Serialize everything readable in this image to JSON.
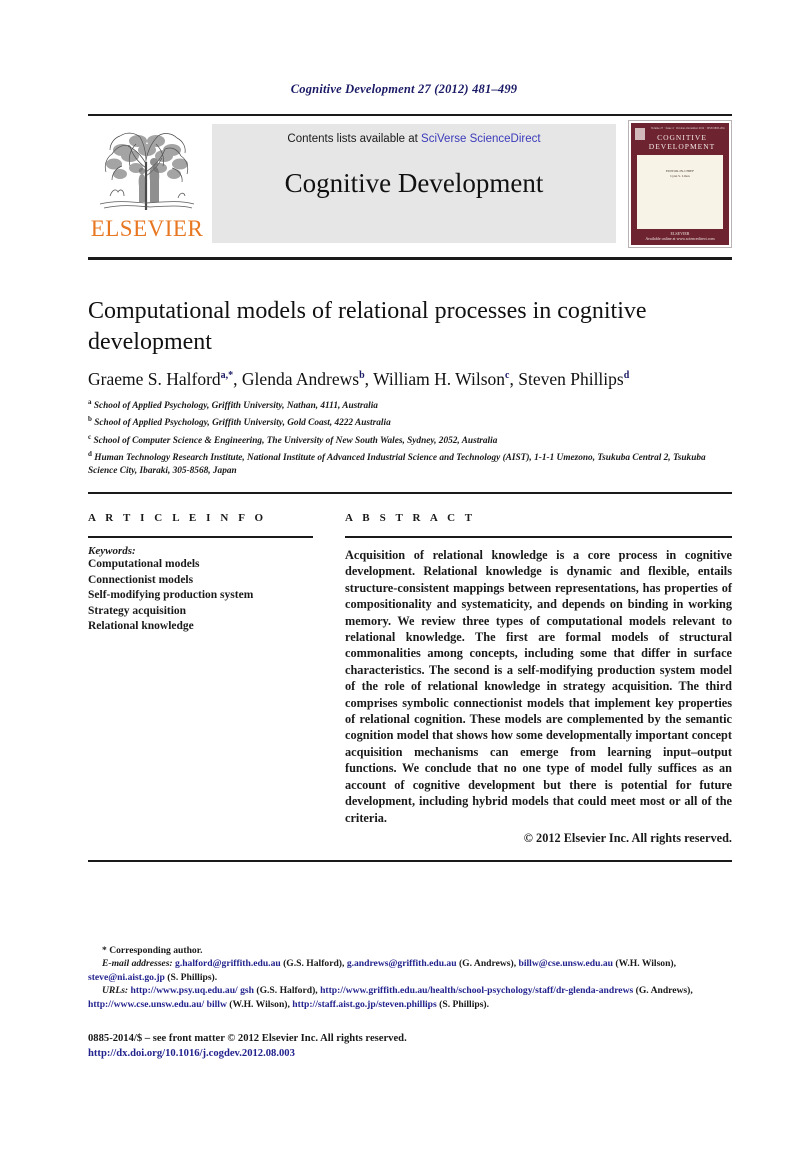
{
  "running_head": "Cognitive Development 27 (2012) 481–499",
  "masthead": {
    "publisher_name": "ELSEVIER",
    "publisher_logo_alt": "elsevier-tree-logo",
    "contents_prefix": "Contents lists available at ",
    "contents_link": "SciVerse ScienceDirect",
    "journal_name": "Cognitive Development",
    "cover": {
      "top_meta": "Volume 27 · Issue 4 · October–December 2012 · ISSN 0885-2014",
      "title_line1": "COGNITIVE",
      "title_line2": "DEVELOPMENT",
      "white_text_line1": "EDITOR-IN-CHIEF",
      "white_text_line2": "Lynn S. Liben",
      "foot_line1": "ELSEVIER",
      "foot_line2": "Available online at www.sciencedirect.com"
    }
  },
  "article": {
    "title": "Computational models of relational processes in cognitive development",
    "authors": [
      {
        "name": "Graeme S. Halford",
        "marks": "a,*"
      },
      {
        "name": "Glenda Andrews",
        "marks": "b"
      },
      {
        "name": "William H. Wilson",
        "marks": "c"
      },
      {
        "name": "Steven Phillips",
        "marks": "d"
      }
    ],
    "affiliations": [
      {
        "mark": "a",
        "text": "School of Applied Psychology, Griffith University, Nathan, 4111, Australia"
      },
      {
        "mark": "b",
        "text": "School of Applied Psychology, Griffith University, Gold Coast, 4222 Australia"
      },
      {
        "mark": "c",
        "text": "School of Computer Science & Engineering, The University of New South Wales, Sydney, 2052, Australia"
      },
      {
        "mark": "d",
        "text": "Human Technology Research Institute, National Institute of Advanced Industrial Science and Technology (AIST), 1-1-1 Umezono, Tsukuba Central 2, Tsukuba Science City, Ibaraki, 305-8568, Japan"
      }
    ]
  },
  "article_info": {
    "heading": "A R T I C L E   I N F O",
    "keywords_label": "Keywords:",
    "keywords": [
      "Computational models",
      "Connectionist models",
      "Self-modifying production system",
      "Strategy acquisition",
      "Relational knowledge"
    ]
  },
  "abstract": {
    "heading": "A B S T R A C T",
    "text": "Acquisition of relational knowledge is a core process in cognitive development. Relational knowledge is dynamic and flexible, entails structure-consistent mappings between representations, has properties of compositionality and systematicity, and depends on binding in working memory. We review three types of computational models relevant to relational knowledge. The first are formal models of structural commonalities among concepts, including some that differ in surface characteristics. The second is a self-modifying production system model of the role of relational knowledge in strategy acquisition. The third comprises symbolic connectionist models that implement key properties of relational cognition. These models are complemented by the semantic cognition model that shows how some developmentally important concept acquisition mechanisms can emerge from learning input–output functions. We conclude that no one type of model fully suffices as an account of cognitive development but there is potential for future development, including hybrid models that could meet most or all of the criteria.",
    "copyright": "© 2012 Elsevier Inc. All rights reserved."
  },
  "footnotes": {
    "corresponding_author": "* Corresponding author.",
    "email_label": "E-mail addresses:",
    "emails": [
      {
        "address": "g.halford@griffith.edu.au",
        "person": "(G.S. Halford)"
      },
      {
        "address": "g.andrews@griffith.edu.au",
        "person": "(G. Andrews)"
      },
      {
        "address": "billw@cse.unsw.edu.au",
        "person": "(W.H. Wilson)"
      },
      {
        "address": "steve@ni.aist.go.jp",
        "person": "(S. Phillips)"
      }
    ],
    "urls_label": "URLs:",
    "urls": [
      {
        "address": "http://www.psy.uq.edu.au/ gsh",
        "person": "(G.S. Halford)"
      },
      {
        "address": "http://www.griffith.edu.au/health/school-psychology/staff/dr-glenda-andrews",
        "person": "(G. Andrews)"
      },
      {
        "address": "http://www.cse.unsw.edu.au/ billw",
        "person": "(W.H. Wilson)"
      },
      {
        "address": "http://staff.aist.go.jp/steven.phillips",
        "person": "(S. Phillips)"
      }
    ]
  },
  "imprint": {
    "front_matter": "0885-2014/$ – see front matter © 2012 Elsevier Inc. All rights reserved.",
    "doi": "http://dx.doi.org/10.1016/j.cogdev.2012.08.003"
  },
  "colors": {
    "running_head": "#1a1a66",
    "link": "#23238e",
    "sciencedirect": "#3b3bbb",
    "elsevier_orange": "#e87722",
    "cover_maroon": "#6d2430",
    "band_gray": "#e6e6e6"
  }
}
